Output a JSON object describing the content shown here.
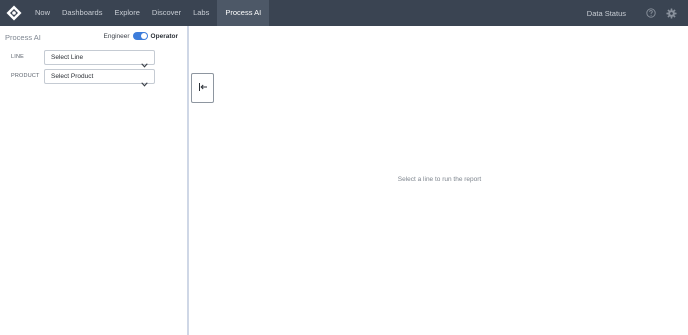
{
  "nav": {
    "logo": "brand-logo",
    "items": [
      {
        "label": "Now"
      },
      {
        "label": "Dashboards"
      },
      {
        "label": "Explore"
      },
      {
        "label": "Discover"
      },
      {
        "label": "Labs"
      }
    ],
    "active_item": {
      "label": "Process AI"
    },
    "data_status": "Data Status",
    "help_icon": "help-circle-icon",
    "settings_icon": "gear-icon"
  },
  "panel": {
    "title": "Process AI",
    "mode": {
      "left_label": "Engineer",
      "right_label": "Operator",
      "selected": "Operator"
    },
    "fields": [
      {
        "label": "LINE",
        "value": "Select Line"
      },
      {
        "label": "PRODUCT",
        "value": "Select Product"
      }
    ]
  },
  "main": {
    "empty_message": "Select a line to run the report"
  },
  "colors": {
    "navbar": "#3a4452",
    "active_tab": "#4d5867",
    "toggle_accent": "#3d7ddb"
  }
}
